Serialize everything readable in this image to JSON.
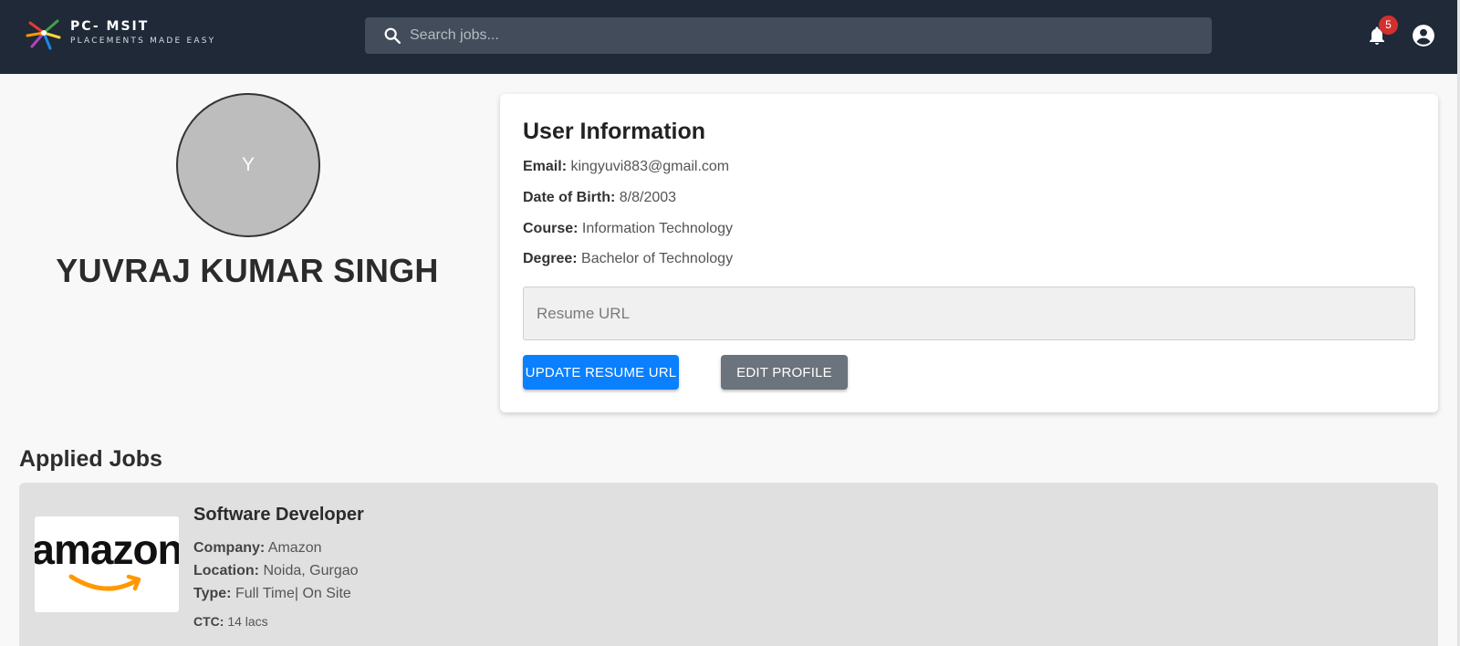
{
  "header": {
    "brand_title": "PC- MSIT",
    "brand_tagline": "PLACEMENTS MADE EASY",
    "search_placeholder": "Search jobs...",
    "notification_count": "5",
    "colors": {
      "topbar": "#1f2937",
      "badge": "#d32f2f"
    }
  },
  "profile": {
    "avatar_initial": "Y",
    "name": "YUVRAJ KUMAR SINGH"
  },
  "user_info": {
    "title": "User Information",
    "email_label": "Email:",
    "email": "kingyuvi883@gmail.com",
    "dob_label": "Date of Birth:",
    "dob": "8/8/2003",
    "course_label": "Course:",
    "course": "Information Technology",
    "degree_label": "Degree:",
    "degree": "Bachelor of Technology",
    "resume_placeholder": "Resume URL",
    "resume_value": "",
    "update_button": "UPDATE RESUME URL",
    "edit_button": "EDIT PROFILE",
    "colors": {
      "primary": "#0a80ff",
      "secondary": "#6b737c"
    }
  },
  "applied_jobs": {
    "title": "Applied Jobs",
    "jobs": [
      {
        "title": "Software Developer",
        "logo_icon": "amazon-logo",
        "logo_text": "amazon",
        "company_label": "Company:",
        "company": "Amazon",
        "location_label": "Location:",
        "location": "Noida, Gurgao",
        "type_label": "Type:",
        "type": "Full Time| On Site",
        "ctc_label": "CTC:",
        "ctc": "14 lacs"
      }
    ]
  }
}
